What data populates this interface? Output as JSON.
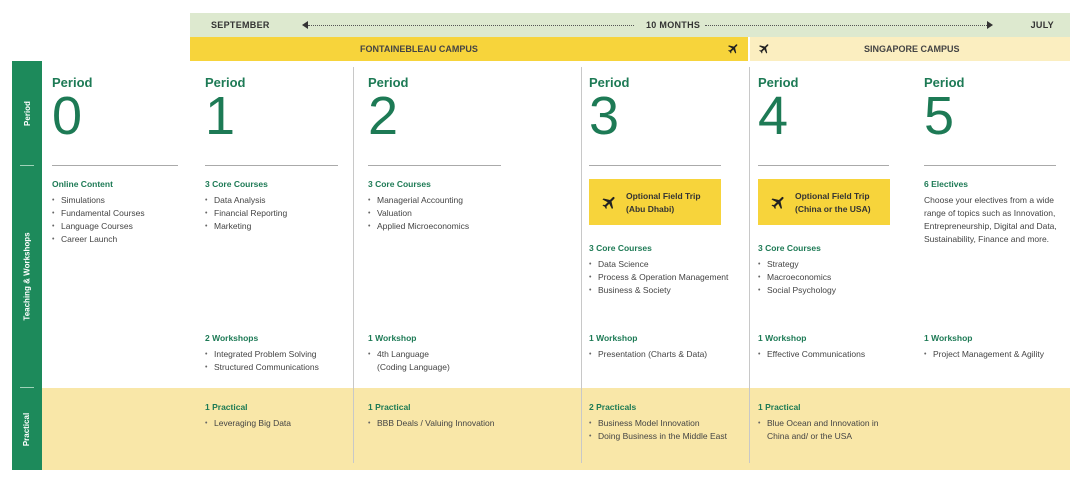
{
  "timeline": {
    "start": "SEPTEMBER",
    "duration": "10 MONTHS",
    "end": "JULY"
  },
  "campuses": {
    "fontainebleau": "FONTAINEBLEAU CAMPUS",
    "singapore": "SINGAPORE CAMPUS"
  },
  "sidebar": {
    "period": "Period",
    "teaching": "Teaching & Workshops",
    "practical": "Practical"
  },
  "period_word": "Period",
  "periods": [
    {
      "number": "0",
      "content_heading": "Online Content",
      "content_items": [
        "Simulations",
        "Fundamental Courses",
        "Language Courses",
        "Career Launch"
      ]
    },
    {
      "number": "1",
      "content_heading": "3 Core Courses",
      "content_items": [
        "Data Analysis",
        "Financial Reporting",
        "Marketing"
      ],
      "workshop_heading": "2 Workshops",
      "workshop_items": [
        "Integrated Problem Solving",
        "Structured Communications"
      ],
      "practical_heading": "1 Practical",
      "practical_items": [
        "Leveraging Big Data"
      ]
    },
    {
      "number": "2",
      "content_heading": "3 Core Courses",
      "content_items": [
        "Managerial Accounting",
        "Valuation",
        "Applied Microeconomics"
      ],
      "workshop_heading": "1 Workshop",
      "workshop_items": [
        "4th Language",
        "(Coding Language)"
      ],
      "practical_heading": "1 Practical",
      "practical_items": [
        "BBB Deals / Valuing Innovation"
      ]
    },
    {
      "number": "3",
      "trip": [
        "Optional Field Trip",
        "(Abu Dhabi)"
      ],
      "content_heading": "3 Core Courses",
      "content_items": [
        "Data Science",
        "Process & Operation Management",
        "Business & Society"
      ],
      "workshop_heading": "1 Workshop",
      "workshop_items": [
        "Presentation (Charts & Data)"
      ],
      "practical_heading": "2 Practicals",
      "practical_items": [
        "Business Model Innovation",
        "Doing Business in the Middle East"
      ]
    },
    {
      "number": "4",
      "trip": [
        "Optional Field Trip",
        "(China or the USA)"
      ],
      "content_heading": "3 Core Courses",
      "content_items": [
        "Strategy",
        "Macroeconomics",
        "Social Psychology"
      ],
      "workshop_heading": "1 Workshop",
      "workshop_items": [
        "Effective Communications"
      ],
      "practical_heading": "1 Practical",
      "practical_items": [
        "Blue Ocean and Innovation in",
        "China and/ or the USA"
      ]
    },
    {
      "number": "5",
      "content_heading": "6 Electives",
      "description": [
        "Choose your electives from a wide",
        "range of topics such as Innovation,",
        "Entrepreneurship, Digital and Data,",
        "Sustainability, Finance and more."
      ],
      "workshop_heading": "1 Workshop",
      "workshop_items": [
        "Project Management & Agility"
      ]
    }
  ],
  "colors": {
    "green": "#1d8a5b",
    "yellow": "#f7d43b",
    "pale_yellow": "#f9e7a8",
    "pale_green": "#dde9cf"
  }
}
